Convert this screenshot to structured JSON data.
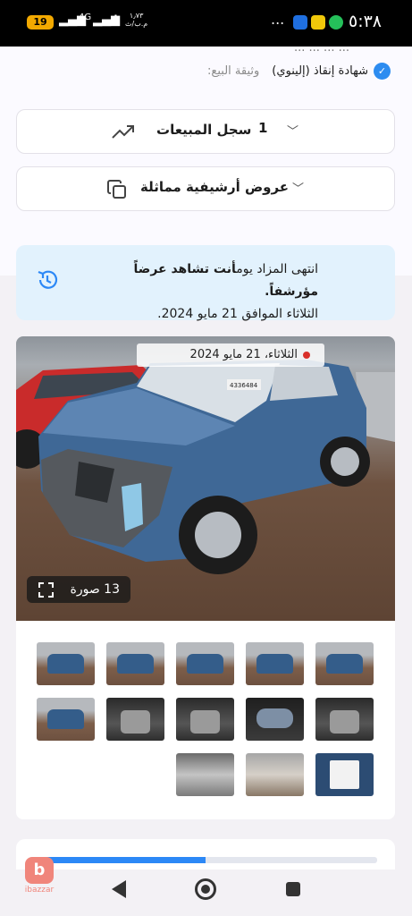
{
  "status_bar": {
    "battery": "19",
    "network": "4G",
    "speed_value": "١٫٧٣",
    "speed_unit": "م.ب/ث",
    "more": "...",
    "time": "٥:٣٨"
  },
  "details": {
    "partial_line": "... ... ... ...",
    "certificate": "شهادة إنقاذ (إلينوي)",
    "sale_document_label": "وثيقة البيع:"
  },
  "sales_history": {
    "label": "سجل المبيعات",
    "count": "1"
  },
  "similar_archived": {
    "label": "عروض أرشيفية مماثلة"
  },
  "notice": {
    "prefix": "انتهى المزاد يوم",
    "bold": "أنت تشاهد عرضاً مؤرشفاً.",
    "date": "الثلاثاء الموافق 21 مايو 2024."
  },
  "gallery": {
    "date": "الثلاثاء، 21 مايو 2024",
    "photo_count": "13 صورة",
    "lot_sticker": "4336484",
    "thumbnails": [
      "ext",
      "ext",
      "ext",
      "ext",
      "ext",
      "int",
      "dash",
      "int",
      "int",
      "ext",
      "sticker",
      "parts",
      "eng"
    ]
  },
  "progress": {
    "value": 0.5
  },
  "brand": {
    "logo_letter": "b",
    "name": "ibazzar"
  },
  "colors": {
    "accent": "#2c88f6",
    "verified": "#2d8cf0",
    "notice_bg": "#e2f2fd",
    "status_dot": "#d9302a",
    "brand": "#f0857b"
  }
}
